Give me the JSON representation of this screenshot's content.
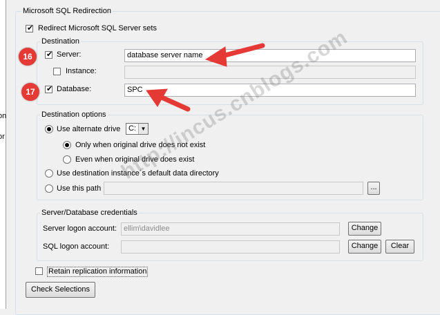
{
  "left_fragments": [
    "on",
    "or"
  ],
  "section_title": "Microsoft SQL Redirection",
  "redirect": {
    "label": "Redirect Microsoft SQL Server sets",
    "checked": true
  },
  "destination": {
    "title": "Destination",
    "server": {
      "label": "Server:",
      "checked": true,
      "value": "database server name"
    },
    "instance": {
      "label": "Instance:",
      "checked": false,
      "value": ""
    },
    "database": {
      "label": "Database:",
      "checked": true,
      "value": "SPC"
    }
  },
  "destination_options": {
    "title": "Destination options",
    "use_alternate_drive": {
      "label": "Use alternate drive",
      "selected": true,
      "drive": "C:"
    },
    "only_when_not_exist": {
      "label": "Only when original drive does not exist",
      "selected": true
    },
    "even_when_exist": {
      "label": "Even when original drive does exist",
      "selected": false
    },
    "default_dir": {
      "label": "Use destination instance´s default data directory",
      "selected": false
    },
    "this_path": {
      "label": "Use this path",
      "selected": false,
      "value": "",
      "browse": "..."
    }
  },
  "credentials": {
    "title": "Server/Database credentials",
    "server_logon": {
      "label": "Server logon account:",
      "value": "ellim\\davidlee",
      "change": "Change"
    },
    "sql_logon": {
      "label": "SQL logon account:",
      "value": "",
      "change": "Change",
      "clear": "Clear"
    }
  },
  "retain": {
    "label": "Retain replication information",
    "checked": false
  },
  "check_selections": "Check Selections",
  "annotations": {
    "badge_16": "16",
    "badge_17": "17",
    "accent": "#e53935"
  },
  "watermark": "http://incus.cnblogs.com"
}
